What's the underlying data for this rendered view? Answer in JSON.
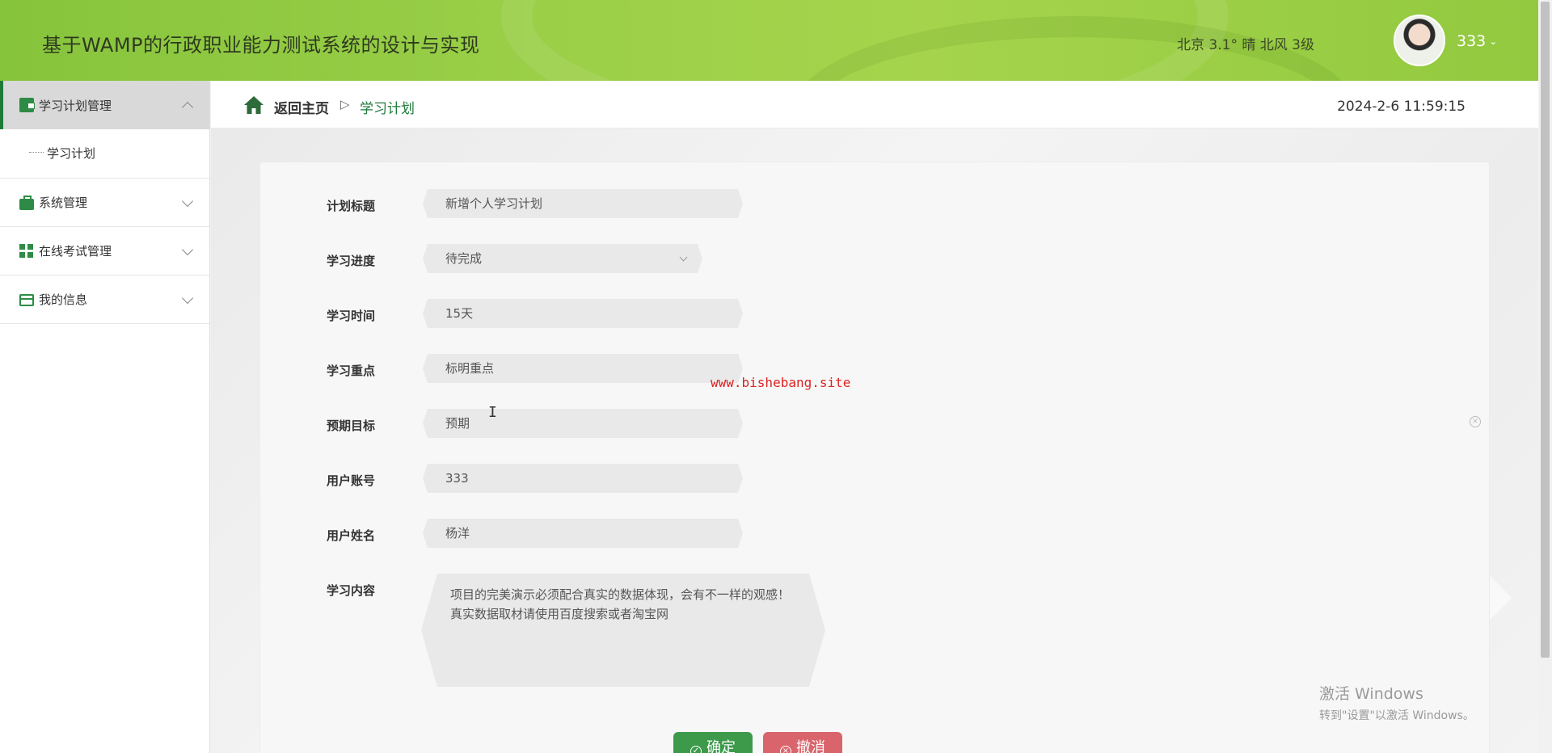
{
  "header": {
    "title": "基于WAMP的行政职业能力测试系统的设计与实现",
    "weather": "北京  3.1°  晴  北风  3级",
    "username": "333"
  },
  "sidebar": {
    "groups": [
      {
        "label": "学习计划管理",
        "icon": "wallet-icon",
        "expanded": true,
        "items": [
          "学习计划"
        ]
      },
      {
        "label": "系统管理",
        "icon": "briefcase-icon",
        "expanded": false
      },
      {
        "label": "在线考试管理",
        "icon": "grid-icon",
        "expanded": false
      },
      {
        "label": "我的信息",
        "icon": "card-icon",
        "expanded": false
      }
    ]
  },
  "breadcrumb": {
    "home": "返回主页",
    "separator": "▷",
    "current": "学习计划"
  },
  "datetime": "2024-2-6 11:59:15",
  "form": {
    "plan_title": {
      "label": "计划标题",
      "value": "新增个人学习计划"
    },
    "progress": {
      "label": "学习进度",
      "value": "待完成"
    },
    "duration": {
      "label": "学习时间",
      "value": "15天"
    },
    "focus": {
      "label": "学习重点",
      "value": "标明重点"
    },
    "goal": {
      "label": "预期目标",
      "value": "预期"
    },
    "account": {
      "label": "用户账号",
      "value": "333"
    },
    "name": {
      "label": "用户姓名",
      "value": "杨洋"
    },
    "content": {
      "label": "学习内容",
      "value": "项目的完美演示必须配合真实的数据体现，会有不一样的观感！真实数据取材请使用百度搜索或者淘宝网"
    }
  },
  "buttons": {
    "ok": "确定",
    "cancel": "撤消"
  },
  "watermark": "www.bishebang.site",
  "windows": {
    "line1": "激活 Windows",
    "line2": "转到\"设置\"以激活 Windows。"
  },
  "colors": {
    "header_green": "#9bcf48",
    "accent": "#1f7a3a",
    "ok": "#3c9a4a",
    "cancel": "#d9646b"
  }
}
